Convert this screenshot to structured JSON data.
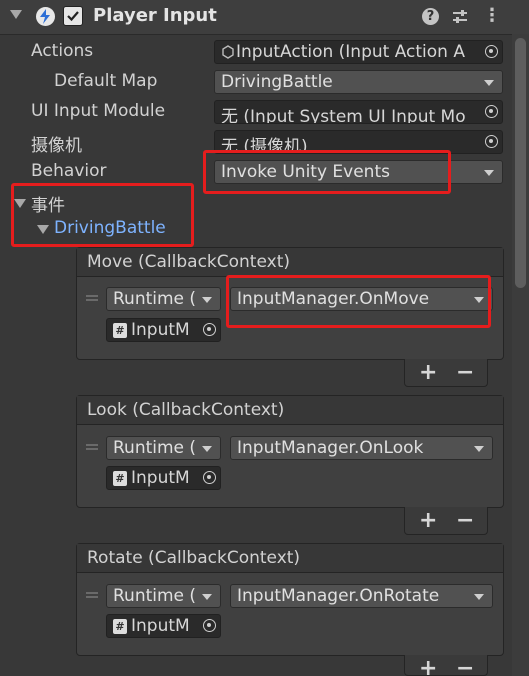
{
  "component": {
    "title": "Player Input",
    "help_glyph": "?",
    "menu_glyph": "⋮"
  },
  "properties": {
    "actions": {
      "label": "Actions",
      "value": "InputAction (Input Action A"
    },
    "default_map": {
      "label": "Default Map",
      "value": "DrivingBattle"
    },
    "ui_input_module": {
      "label": "UI Input Module",
      "value": "无 (Input System UI Input Mo"
    },
    "camera": {
      "label": "摄像机",
      "value": "无 (摄像机)"
    },
    "behavior": {
      "label": "Behavior",
      "value": "Invoke Unity Events"
    }
  },
  "events": {
    "label": "事件",
    "map_name": "DrivingBattle",
    "list": [
      {
        "title": "Move (CallbackContext)",
        "runtime": "Runtime (",
        "function": "InputManager.OnMove",
        "object": "InputM"
      },
      {
        "title": "Look (CallbackContext)",
        "runtime": "Runtime (",
        "function": "InputManager.OnLook",
        "object": "InputM"
      },
      {
        "title": "Rotate (CallbackContext)",
        "runtime": "Runtime (",
        "function": "InputManager.OnRotate",
        "object": "InputM"
      }
    ],
    "add_glyph": "+",
    "remove_glyph": "−",
    "script_glyph": "#"
  }
}
